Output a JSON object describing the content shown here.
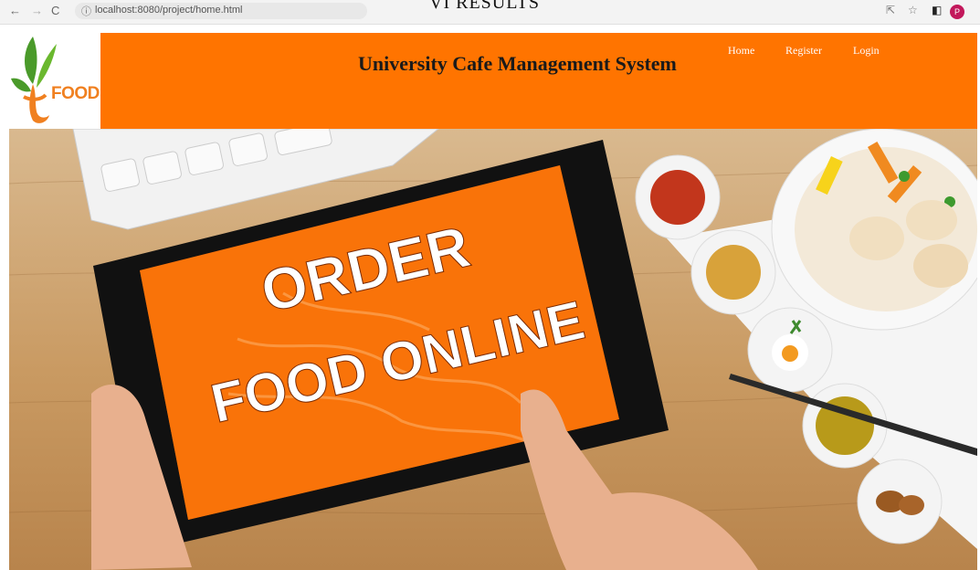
{
  "browser": {
    "url": "localhost:8080/project/home.html",
    "avatar_letter": "P"
  },
  "overlay_heading": "VI RESULTS",
  "logo": {
    "text": "FOOD"
  },
  "header": {
    "title": "University Cafe Management System",
    "nav": [
      {
        "label": "Home"
      },
      {
        "label": "Register"
      },
      {
        "label": "Login"
      }
    ]
  },
  "hero": {
    "screen_line1": "ORDER",
    "screen_line2": "FOOD ONLINE"
  },
  "colors": {
    "brand_orange": "#ff7400",
    "logo_green": "#4a9a2a",
    "logo_orange": "#f08020"
  }
}
